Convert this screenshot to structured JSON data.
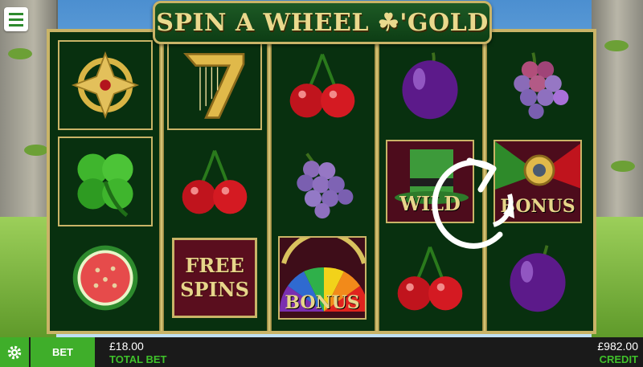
{
  "game": {
    "title": "SPIN A WHEEL ☘'GOLD"
  },
  "reels": [
    [
      "celtic-cross",
      "clover",
      "watermelon"
    ],
    [
      "golden-harp-seven",
      "cherries",
      "free-spins"
    ],
    [
      "cherries",
      "grapes",
      "bonus-wheel"
    ],
    [
      "plum",
      "wild",
      "cherries"
    ],
    [
      "grapes",
      "bonus",
      "plum"
    ]
  ],
  "symbols": {
    "free_spins_line1": "FREE",
    "free_spins_line2": "SPINS",
    "bonus_label": "BONUS",
    "wild_label": "WILD"
  },
  "bottom_bar": {
    "bet_label": "BET",
    "total_bet_value": "£18.00",
    "total_bet_label": "TOTAL BET",
    "credit_value": "£982.00",
    "credit_label": "CREDIT"
  },
  "colors": {
    "accent_green": "#3fae2a",
    "gold": "#c9b467",
    "reel_bg": "#08300f"
  }
}
